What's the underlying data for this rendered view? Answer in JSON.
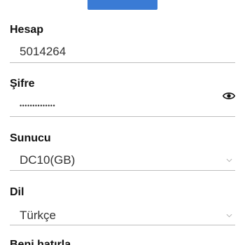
{
  "account": {
    "label": "Hesap",
    "value": "5014264"
  },
  "password": {
    "label": "Şifre",
    "value": "••••••••••••••"
  },
  "server": {
    "label": "Sunucu",
    "value": "DC10(GB)"
  },
  "language": {
    "label": "Dil",
    "value": "Türkçe"
  },
  "next_section": {
    "label": "Beni hatırla"
  },
  "icons": {
    "password_toggle": "eye-icon",
    "dropdown": "chevron-down-icon"
  },
  "colors": {
    "top_button": "#3a7bd5",
    "underline": "#bdbdbd"
  }
}
